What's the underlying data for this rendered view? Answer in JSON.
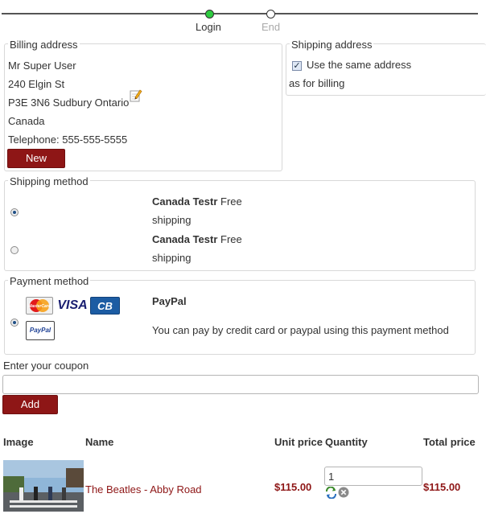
{
  "progress": {
    "steps": [
      {
        "label": "Login",
        "state": "active"
      },
      {
        "label": "End",
        "state": "pending"
      }
    ]
  },
  "billing": {
    "legend": "Billing address",
    "lines": [
      "Mr Super User",
      "240 Elgin St",
      "P3E 3N6 Sudbury Ontario",
      "Canada",
      "Telephone: 555-555-5555"
    ],
    "new_button": "New"
  },
  "shipping_address": {
    "legend": "Shipping address",
    "same_label_1": "Use the same address",
    "same_label_2": "as for billing",
    "same_checked": true
  },
  "shipping_method": {
    "legend": "Shipping method",
    "options": [
      {
        "name": "Canada Testr",
        "desc_1": "Free",
        "desc_2": "shipping",
        "selected": true
      },
      {
        "name": "Canada Testr",
        "desc_1": "Free",
        "desc_2": "shipping",
        "selected": false
      }
    ]
  },
  "payment_method": {
    "legend": "Payment method",
    "option": {
      "name": "PayPal",
      "description": "You can pay by credit card or paypal using this payment method",
      "selected": true,
      "cards": [
        "MasterCard",
        "VISA",
        "CB",
        "PayPal"
      ]
    }
  },
  "coupon": {
    "label": "Enter your coupon",
    "value": "",
    "add_button": "Add"
  },
  "cart": {
    "headers": {
      "image": "Image",
      "name": "Name",
      "unit_price": "Unit price",
      "quantity": "Quantity",
      "total_price": "Total price"
    },
    "items": [
      {
        "name": "The Beatles - Abby Road",
        "unit_price": "$115.00",
        "quantity": "1",
        "total_price": "$115.00"
      }
    ]
  },
  "colors": {
    "accent": "#8e1616",
    "active_step": "#2ecc40",
    "border": "#d8d8d8"
  }
}
